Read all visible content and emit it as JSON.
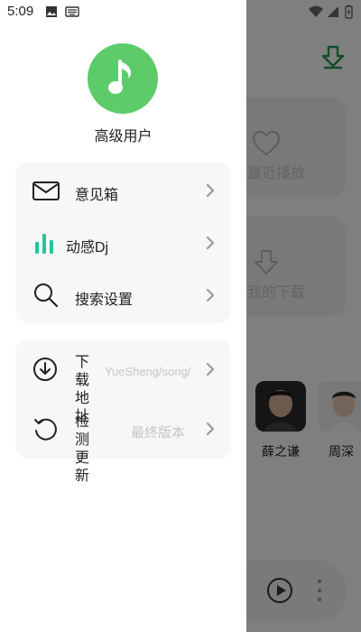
{
  "status_bar": {
    "time": "5:09"
  },
  "user": {
    "name": "高级用户"
  },
  "menu_group_1": [
    {
      "label": "意见箱",
      "icon": "mail-icon"
    },
    {
      "label": "动感Dj",
      "icon": "equalizer-icon"
    },
    {
      "label": "搜索设置",
      "icon": "search-icon"
    }
  ],
  "menu_group_2": [
    {
      "label": "下载地址",
      "value": "YueSheng/song/",
      "icon": "download-circle-icon"
    },
    {
      "label": "检测更新",
      "value": "最终版本",
      "icon": "refresh-icon"
    }
  ],
  "background": {
    "card_recent": "最近播放",
    "card_download": "我的下载",
    "artists": [
      "薛之谦",
      "周深"
    ]
  },
  "colors": {
    "accent": "#5ecb6b",
    "dj_accent": "#26c69a"
  }
}
